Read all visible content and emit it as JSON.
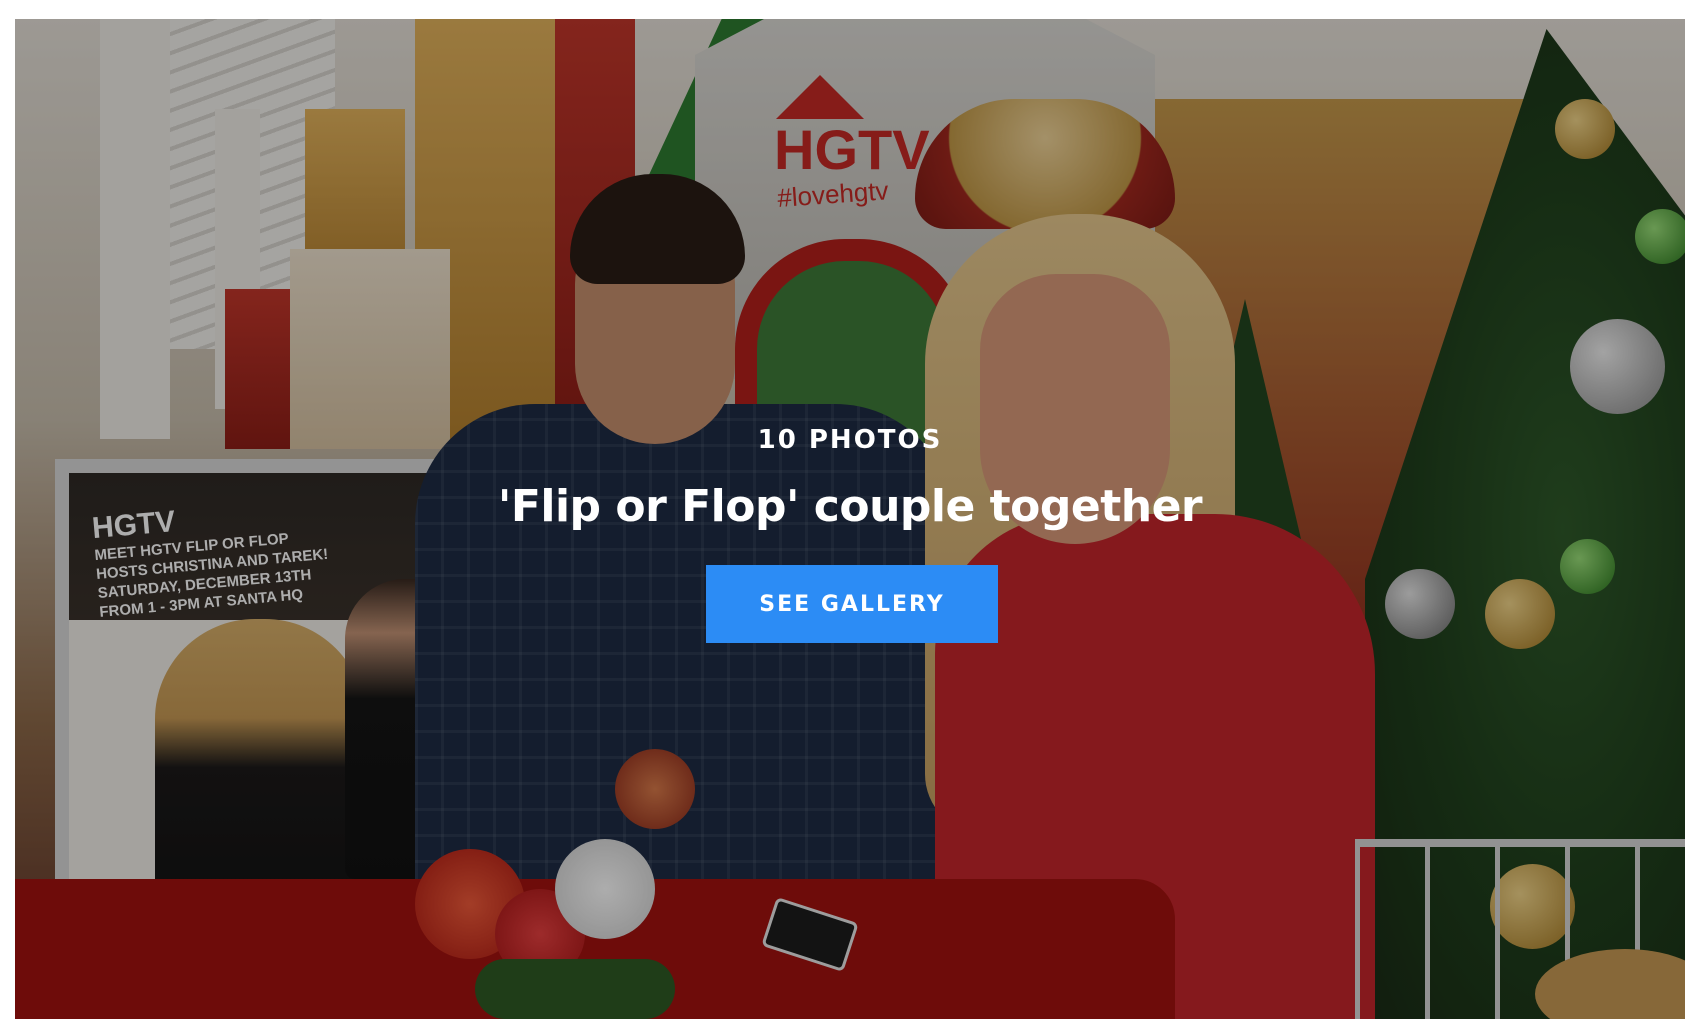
{
  "gallery": {
    "photo_count": "10 PHOTOS",
    "title": "'Flip or Flop' couple together",
    "cta_label": "SEE GALLERY"
  },
  "photo": {
    "booth_sign": {
      "logo": "HGTV",
      "hashtag": "#lovehgtv"
    },
    "poster": {
      "logo": "HGTV",
      "lines": [
        "MEET HGTV FLIP OR FLOP",
        "HOSTS CHRISTINA AND TAREK!",
        "SATURDAY, DECEMBER 13TH",
        "FROM 1 - 3PM AT SANTA HQ"
      ]
    }
  },
  "colors": {
    "cta_background": "#2c8cf5",
    "overlay_text": "#ffffff",
    "page_background": "#ffffff"
  }
}
